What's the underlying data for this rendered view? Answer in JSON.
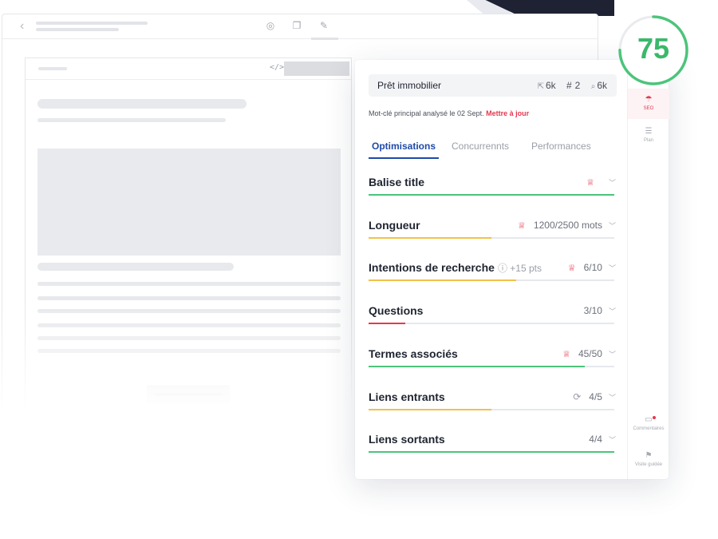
{
  "score": {
    "value": "75",
    "fraction": 0.75,
    "color": "#4cc47a"
  },
  "keyword": {
    "text": "Prêt immobilier",
    "clicks_icon": "cursor-icon",
    "clicks": "6k",
    "position_icon": "hash-icon",
    "position": "2",
    "volume_icon": "search-icon",
    "volume": "6k"
  },
  "analysis": {
    "text": "Mot-clé principal analysé le 02 Sept.",
    "update_label": "Mettre à jour"
  },
  "tabs": [
    {
      "label": "Optimisations",
      "active": true
    },
    {
      "label": "Concurrennts",
      "active": false
    },
    {
      "label": "Performances",
      "active": false
    }
  ],
  "rows": [
    {
      "label": "Balise title",
      "extra": "",
      "value": "",
      "trophy": true,
      "refresh": false,
      "progress": 1.0,
      "color": "#4cc47a"
    },
    {
      "label": "Longueur",
      "extra": "",
      "value": "1200/2500 mots",
      "trophy": true,
      "refresh": false,
      "progress": 0.5,
      "color": "#f2c14a"
    },
    {
      "label": "Intentions de recherche",
      "extra": "+15 pts",
      "value": "6/10",
      "trophy": true,
      "refresh": false,
      "progress": 0.6,
      "color": "#f2c14a"
    },
    {
      "label": "Questions",
      "extra": "",
      "value": "3/10",
      "trophy": false,
      "refresh": false,
      "progress": 0.15,
      "color": "#e5384f"
    },
    {
      "label": "Termes associés",
      "extra": "",
      "value": "45/50",
      "trophy": true,
      "refresh": false,
      "progress": 0.88,
      "color": "#4cc47a"
    },
    {
      "label": "Liens entrants",
      "extra": "",
      "value": "4/5",
      "trophy": false,
      "refresh": true,
      "progress": 0.5,
      "color": "#f2c14a"
    },
    {
      "label": "Liens sortants",
      "extra": "",
      "value": "4/4",
      "trophy": false,
      "refresh": false,
      "progress": 1.0,
      "color": "#4cc47a"
    }
  ],
  "rail": {
    "seo_label": "SEO",
    "plan_label": "Plan",
    "comments_label": "Commentaires",
    "tour_label": "Visite guidée"
  },
  "browser": {
    "icons": [
      "back-chevron-icon",
      "globe-icon",
      "copy-icon",
      "pencil-icon"
    ],
    "code_icon": "</>"
  }
}
